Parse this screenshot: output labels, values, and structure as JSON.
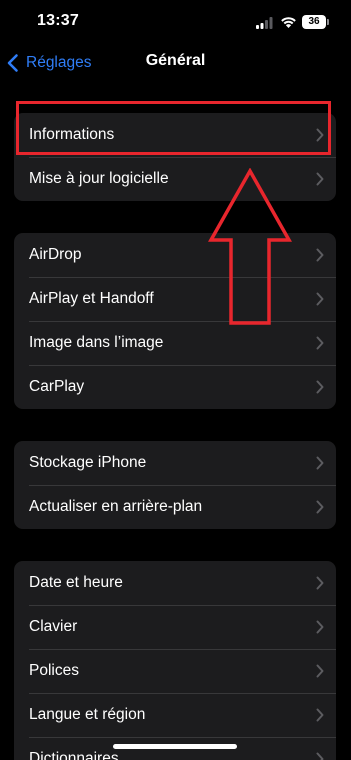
{
  "status_bar": {
    "time": "13:37",
    "battery": "36",
    "icons": [
      "signal-icon",
      "wifi-icon",
      "battery-icon"
    ]
  },
  "nav": {
    "back_label": "Réglages",
    "title": "Général",
    "accent_color": "#2f7df6"
  },
  "groups": [
    {
      "rows": [
        {
          "label": "Informations"
        },
        {
          "label": "Mise à jour logicielle"
        }
      ]
    },
    {
      "rows": [
        {
          "label": "AirDrop"
        },
        {
          "label": "AirPlay et Handoff"
        },
        {
          "label": "Image dans l’image"
        },
        {
          "label": "CarPlay"
        }
      ]
    },
    {
      "rows": [
        {
          "label": "Stockage iPhone"
        },
        {
          "label": "Actualiser en arrière-plan"
        }
      ]
    },
    {
      "rows": [
        {
          "label": "Date et heure"
        },
        {
          "label": "Clavier"
        },
        {
          "label": "Polices"
        },
        {
          "label": "Langue et région"
        },
        {
          "label": "Dictionnaires"
        }
      ]
    }
  ],
  "annotation": {
    "color": "#e8262d",
    "highlighted_item": "Informations",
    "shapes": [
      "highlight-box",
      "up-arrow"
    ]
  }
}
